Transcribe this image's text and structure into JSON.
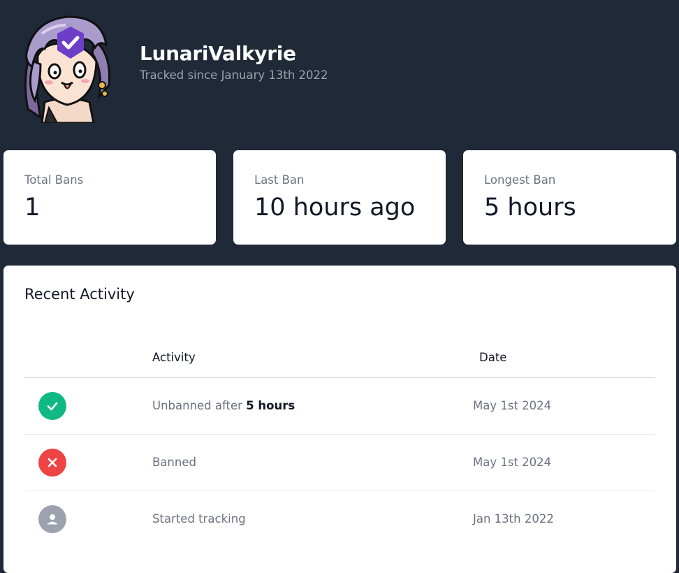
{
  "profile": {
    "username": "LunariValkyrie",
    "tracked_since": "Tracked since January 13th 2022",
    "avatar_icon": "anime-avatar",
    "badge_icon": "verified-check-icon"
  },
  "stats": [
    {
      "label": "Total Bans",
      "value": "1"
    },
    {
      "label": "Last Ban",
      "value": "10 hours ago"
    },
    {
      "label": "Longest Ban",
      "value": "5 hours"
    }
  ],
  "recent_activity": {
    "title": "Recent Activity",
    "columns": {
      "activity": "Activity",
      "date": "Date"
    },
    "rows": [
      {
        "icon": "check-icon",
        "status_color": "#10b981",
        "text": "Unbanned after ",
        "emphasis": "5 hours",
        "date": "May 1st 2024"
      },
      {
        "icon": "x-icon",
        "status_color": "#ef4444",
        "text": "Banned",
        "emphasis": "",
        "date": "May 1st 2024"
      },
      {
        "icon": "user-icon",
        "status_color": "#9ca3af",
        "text": "Started tracking",
        "emphasis": "",
        "date": "Jan 13th 2022"
      }
    ]
  },
  "colors": {
    "page_background": "#1f2937",
    "badge": "#6d3fc8"
  }
}
